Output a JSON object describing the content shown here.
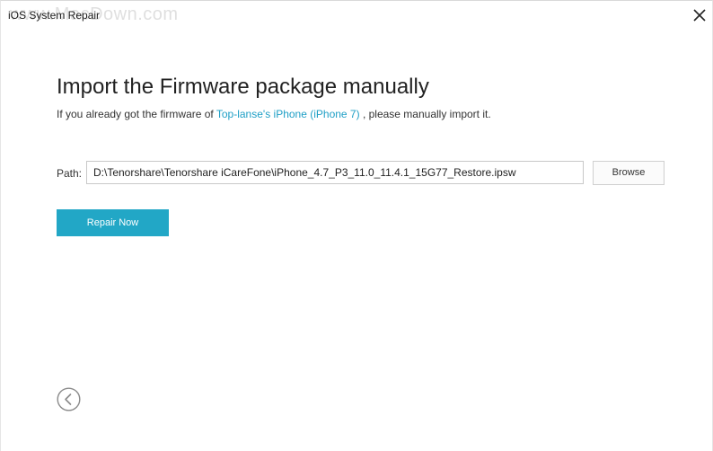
{
  "window": {
    "title": "iOS System Repair",
    "watermark": "www.MacDown.com"
  },
  "main": {
    "heading": "Import the Firmware package manually",
    "subtitle_prefix": "If you already got the firmware of ",
    "device_name": "Top-lanse's iPhone (iPhone 7)",
    "subtitle_suffix": " , please manually import it.",
    "path_label": "Path:",
    "path_value": "D:\\Tenorshare\\Tenorshare iCareFone\\iPhone_4.7_P3_11.0_11.4.1_15G77_Restore.ipsw",
    "browse_label": "Browse",
    "repair_label": "Repair Now"
  },
  "icons": {
    "close": "close-icon",
    "back": "chevron-left-circle-icon"
  },
  "colors": {
    "accent": "#22a7c6",
    "link": "#1f9fc6"
  }
}
